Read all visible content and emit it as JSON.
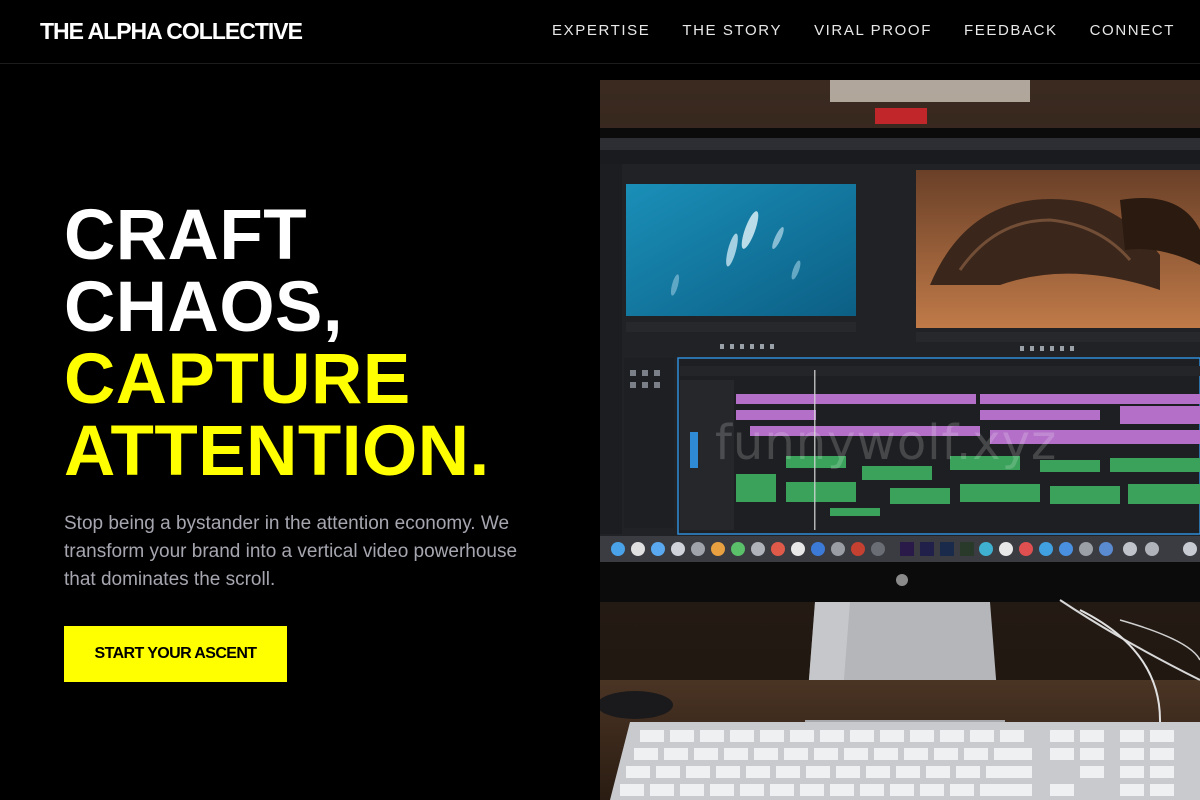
{
  "header": {
    "brand": "THE ALPHA COLLECTIVE",
    "nav": [
      {
        "label": "EXPERTISE"
      },
      {
        "label": "THE STORY"
      },
      {
        "label": "VIRAL PROOF"
      },
      {
        "label": "FEEDBACK"
      },
      {
        "label": "CONNECT"
      }
    ]
  },
  "hero": {
    "headline": {
      "line1": "CRAFT",
      "line2": "CHAOS,",
      "line3": "CAPTURE",
      "line4": "ATTENTION."
    },
    "subtext": "Stop being a bystander in the attention economy. We transform your brand into a vertical video powerhouse that dominates the scroll.",
    "cta_label": "START YOUR ASCENT",
    "image": {
      "subject": "video-editing-workstation-photo",
      "watermark": "funnywolf.xyz"
    }
  },
  "colors": {
    "background": "#000000",
    "accent": "#ffff00",
    "text": "#ffffff",
    "muted": "#a6a6b0"
  }
}
